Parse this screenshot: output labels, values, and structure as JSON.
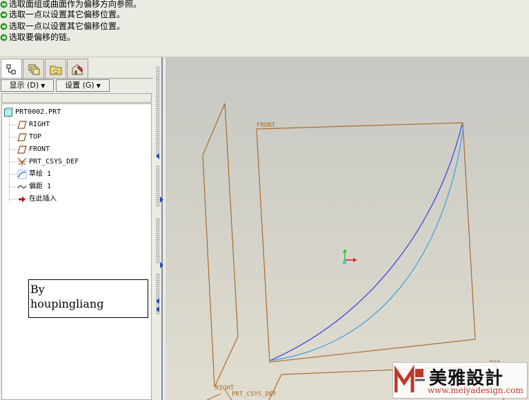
{
  "messages": [
    "选取面组或曲面作为偏移方向参照。",
    "选取一点以设置其它偏移位置。",
    "选取一点以设置其它偏移位置。",
    "选取要偏移的链。"
  ],
  "panel_tabs": [
    "model-tree-icon",
    "layers-icon",
    "favorites-icon",
    "connections-icon"
  ],
  "toolbar": {
    "show_label": "显示 (D)",
    "settings_label": "设置 (G)"
  },
  "model_tree": {
    "root": "PRT0002.PRT",
    "items": [
      {
        "label": "RIGHT",
        "icon": "datum-plane-icon"
      },
      {
        "label": "TOP",
        "icon": "datum-plane-icon"
      },
      {
        "label": "FRONT",
        "icon": "datum-plane-icon"
      },
      {
        "label": "PRT_CSYS_DEF",
        "icon": "csys-icon"
      },
      {
        "label": "草绘 1",
        "icon": "sketch-icon"
      },
      {
        "label": "偏距 1",
        "icon": "offset-curve-icon"
      },
      {
        "label": "在此插入",
        "icon": "insert-here-icon"
      }
    ]
  },
  "annotation": {
    "line1": "By",
    "line2": "houpingliang"
  },
  "viewport": {
    "front_label": "FRONT",
    "right_label": "RIGHT",
    "top_label": "TOP",
    "csys_label": "PRT_CSYS_DEF"
  },
  "watermark": {
    "title": "美雅設計",
    "url": "www.meiyadesign.com"
  },
  "colors": {
    "datum_plane": "#a86a2c",
    "curve_sketch": "#3a3ae0",
    "curve_offset": "#3aa0e0",
    "msg_arrow": "#1ea01e",
    "tree_insert_arrow": "#c01818"
  }
}
